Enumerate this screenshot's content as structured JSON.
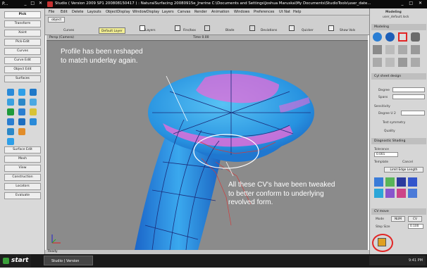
{
  "palette": {
    "title": "P...",
    "buttons": [
      "Pick",
      "Transform",
      "Xoint",
      "Pick-Edit",
      "Curves",
      "Curve Edit",
      "Object Edit",
      "Surfaces",
      "Surface Edit",
      "Mesh",
      "View",
      "Construction",
      "Locators",
      "Evaluate"
    ]
  },
  "main_window": {
    "title": "Studio ( Version 2009 SP1  200808150417 ) : NaturalSurfacing  20080915e_Jrwrine  C:\\Documents and Settings\\Joshua Maruska\\My Documents\\StudioTools\\user_date..."
  },
  "menus": [
    "File",
    "Edit",
    "Delete",
    "Layouts",
    "ObjectDisplay",
    "WindowDisplay",
    "Layers",
    "Canvas",
    "Render",
    "Animation",
    "Windows",
    "Preferences",
    "Ut Nat",
    "Help"
  ],
  "shelf": {
    "tab": "object",
    "shelf_tabs": [
      "Curves",
      "Default Layer",
      "Layers",
      "Fins/box",
      "Blade",
      "Deviations",
      "Quicker"
    ],
    "right_label": "Show Vals"
  },
  "viewport": {
    "header_left": "Persp (Camera)",
    "header_center": "Time 0.00",
    "annotation_top": [
      "Profile has been reshaped",
      "to match underlay again."
    ],
    "annotation_bottom": [
      "All these CV's  have been tweaked",
      "to better conform to underlying",
      "revolved form."
    ],
    "status": "Ready"
  },
  "control_panel": {
    "header": [
      "Modeling",
      "user_default.lock"
    ],
    "section_modeling": "Modeling",
    "section_cv": "Cyl sheet design",
    "fields": {
      "degree_label": "Degree",
      "spans_label": "Spans",
      "sensitivity": "Sensitivity",
      "degree_val": "Degree U 2"
    },
    "test_symmetry": "Test symmetry",
    "quality": "Quality",
    "diag_shading": "Diagnostic Shading",
    "tolerance_label": "Tolerance",
    "tolerance_val": "0.001",
    "toggle_a": "Template",
    "toggle_b": "Cancel",
    "edge_btn": "Limit Edge Length",
    "cv_move": "CV move",
    "mode_label": "Mode",
    "mode_a": "NUM",
    "mode_b": "CV",
    "step_label": "Step Size",
    "step_val": "0.100"
  },
  "taskbar": {
    "start": "start",
    "task": "Studio ( Version 2009...",
    "tray": "9:41 PM"
  },
  "colors": {
    "accent_pink": "#e86bd8",
    "surface_blue": "#2c9de6",
    "highlight_red": "#e22525"
  }
}
